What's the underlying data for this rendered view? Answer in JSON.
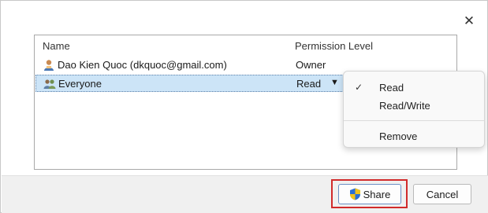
{
  "dialog": {
    "close_icon": "close-icon"
  },
  "list": {
    "headers": {
      "name": "Name",
      "permission": "Permission Level"
    },
    "rows": [
      {
        "name": "Dao Kien Quoc (dkquoc@gmail.com)",
        "permission": "Owner",
        "icon": "user-icon",
        "selected": false
      },
      {
        "name": "Everyone",
        "permission": "Read",
        "icon": "group-icon",
        "selected": true
      }
    ]
  },
  "menu": {
    "items": [
      {
        "label": "Read",
        "checked": true
      },
      {
        "label": "Read/Write",
        "checked": false
      },
      {
        "label": "Remove",
        "checked": false
      }
    ],
    "check_glyph": "✓"
  },
  "buttons": {
    "share_label": "Share",
    "cancel_label": "Cancel",
    "share_icon": "uac-shield-icon"
  },
  "colors": {
    "selection": "#cce4f7",
    "highlight_border": "#d12b2b",
    "shield_blue": "#2b6fd6",
    "shield_yellow": "#f2c31b"
  }
}
